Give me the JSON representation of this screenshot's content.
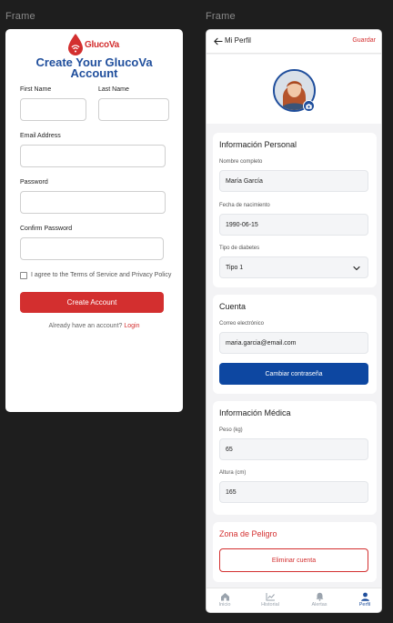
{
  "frames": {
    "left_label": "Frame",
    "right_label": "Frame"
  },
  "signup": {
    "brand": "GlucoVa",
    "title_line1": "Create Your GlucoVa",
    "title_line2": "Account",
    "first_name_label": "First Name",
    "last_name_label": "Last Name",
    "email_label": "Email Address",
    "password_label": "Password",
    "confirm_label": "Confirm Password",
    "agree_text": "I agree to the Terms of Service and Privacy Policy",
    "create_button": "Create Account",
    "have_account": "Already have an account?",
    "login_link": "Login"
  },
  "profile": {
    "title": "Mi Perfil",
    "save": "Guardar",
    "personal": {
      "title": "Información Personal",
      "name_label": "Nombre completo",
      "name_value": "María García",
      "dob_label": "Fecha de nacimiento",
      "dob_value": "1990-06-15",
      "diabetes_label": "Tipo de diabetes",
      "diabetes_value": "Tipo 1"
    },
    "account": {
      "title": "Cuenta",
      "email_label": "Correo electrónico",
      "email_value": "maria.garcia@email.com",
      "change_password": "Cambiar contraseña"
    },
    "medical": {
      "title": "Información Médica",
      "weight_label": "Peso (kg)",
      "weight_value": "65",
      "height_label": "Altura (cm)",
      "height_value": "165"
    },
    "danger": {
      "title": "Zona de Peligro",
      "delete": "Eliminar cuenta"
    },
    "nav": [
      {
        "label": "Inicio",
        "icon": "home-icon"
      },
      {
        "label": "Historial",
        "icon": "chart-icon"
      },
      {
        "label": "Alertas",
        "icon": "bell-icon"
      },
      {
        "label": "Perfil",
        "icon": "user-icon"
      }
    ]
  },
  "colors": {
    "brand_red": "#d32f2f",
    "brand_blue": "#1f4e9c",
    "button_blue": "#0d47a1"
  }
}
